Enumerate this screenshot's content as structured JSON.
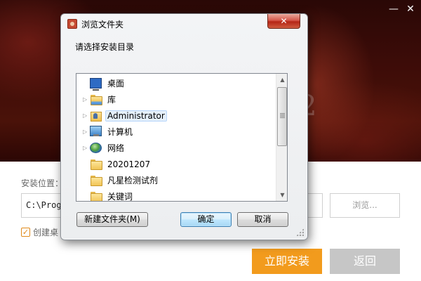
{
  "installer": {
    "banner_mark": "2",
    "minimize_label": "—",
    "close_label": "✕",
    "location_label": "安装位置：",
    "path_value": "C:\\Progr",
    "browse_label": "浏览...",
    "shortcut_label": "创建桌",
    "shortcut_checked": true,
    "install_label": "立即安装",
    "back_label": "返回",
    "colors": {
      "install_button": "#f29b1d",
      "back_button": "#c6c6c6",
      "checkbox": "#e08a1a"
    }
  },
  "dialog": {
    "title": "浏览文件夹",
    "close_label": "✕",
    "prompt": "请选择安装目录",
    "tree": [
      {
        "label": "桌面",
        "icon": "desktop-icon",
        "expandable": false,
        "indent": 0
      },
      {
        "label": "库",
        "icon": "library-folder-icon",
        "expandable": true,
        "indent": 1
      },
      {
        "label": "Administrator",
        "icon": "user-folder-icon",
        "expandable": true,
        "indent": 1,
        "selected": true
      },
      {
        "label": "计算机",
        "icon": "computer-icon",
        "expandable": true,
        "indent": 1
      },
      {
        "label": "网络",
        "icon": "network-icon",
        "expandable": true,
        "indent": 1
      },
      {
        "label": "20201207",
        "icon": "folder-icon",
        "expandable": false,
        "indent": 1
      },
      {
        "label": "凡星检测试剂",
        "icon": "folder-icon",
        "expandable": false,
        "indent": 1
      },
      {
        "label": "关键词",
        "icon": "folder-icon",
        "expandable": false,
        "indent": 1
      }
    ],
    "new_folder_label": "新建文件夹(M)",
    "ok_label": "确定",
    "cancel_label": "取消"
  }
}
